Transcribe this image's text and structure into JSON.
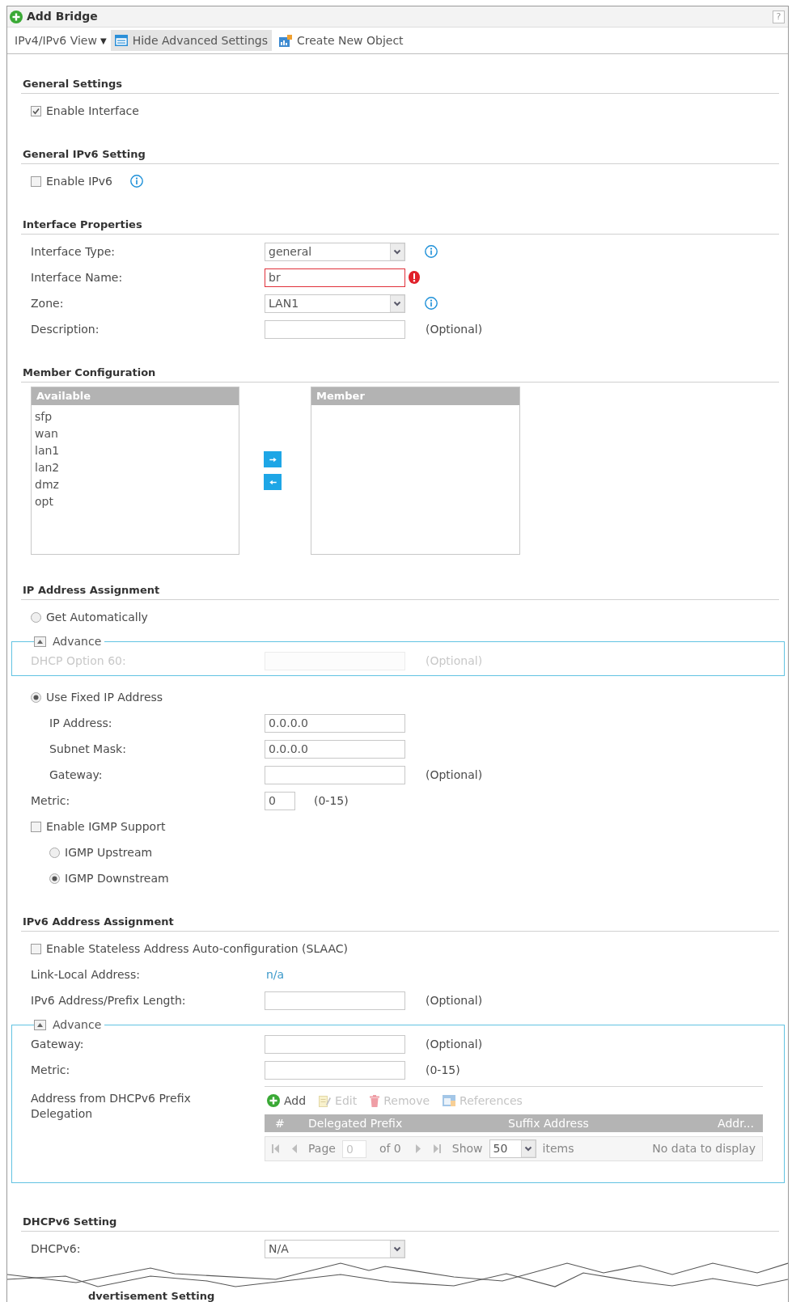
{
  "window": {
    "title": "Add Bridge",
    "help": "?"
  },
  "toolbar": [
    {
      "kind": "menu",
      "label": "IPv4/IPv6 View",
      "caret": "▼",
      "active": false
    },
    {
      "kind": "advanced",
      "label": "Hide Advanced Settings",
      "active": true
    },
    {
      "kind": "create",
      "label": "Create New Object",
      "active": false
    }
  ],
  "sections": [
    {
      "heading": "General Settings",
      "rows": [
        {
          "kind": "checkbox",
          "label": "Enable Interface",
          "checked": true
        }
      ]
    },
    {
      "heading": "General IPv6 Setting",
      "rows": [
        {
          "kind": "checkbox",
          "label": "Enable IPv6",
          "checked": false,
          "info": true
        }
      ]
    },
    {
      "heading": "Interface Properties",
      "rows": [
        {
          "kind": "select",
          "label": "Interface Type:",
          "value": "general",
          "info": true
        },
        {
          "kind": "text",
          "label": "Interface Name:",
          "value": "br",
          "error": true
        },
        {
          "kind": "select",
          "label": "Zone:",
          "value": "LAN1",
          "info": true
        },
        {
          "kind": "text",
          "label": "Description:",
          "note": "(Optional)"
        }
      ]
    },
    {
      "heading": "Member Configuration",
      "rows": [
        {
          "kind": "members",
          "available": {
            "title": "Available",
            "items": [
              {
                "label": "sfp",
                "selected": false
              },
              {
                "label": "wan",
                "selected": false
              },
              {
                "label": "lan1",
                "selected": false
              },
              {
                "label": "lan2",
                "selected": false
              },
              {
                "label": "dmz",
                "selected": false
              },
              {
                "label": "opt",
                "selected": false
              }
            ]
          },
          "member": {
            "title": "Member"
          }
        }
      ]
    },
    {
      "heading": "IP Address Assignment",
      "rows": [
        {
          "kind": "radio",
          "label": "Get Automatically",
          "selected": false
        },
        {
          "kind": "advance",
          "legend": "Advance",
          "expanded": true,
          "rows": [
            {
              "kind": "text",
              "label": "DHCP Option 60:",
              "note": "(Optional)",
              "disabled": true
            }
          ]
        },
        {
          "kind": "radio",
          "label": "Use Fixed IP Address",
          "selected": true,
          "children": [
            {
              "kind": "text",
              "label": "IP Address:",
              "value": "0.0.0.0"
            },
            {
              "kind": "text",
              "label": "Subnet Mask:",
              "value": "0.0.0.0"
            },
            {
              "kind": "text",
              "label": "Gateway:",
              "note": "(Optional)"
            }
          ]
        },
        {
          "kind": "short",
          "label": "Metric:",
          "value": "0",
          "note": "(0-15)"
        },
        {
          "kind": "checkbox",
          "label": "Enable IGMP Support",
          "checked": false,
          "children": [
            {
              "kind": "radio",
              "label": "IGMP Upstream",
              "selected": false
            },
            {
              "kind": "radio",
              "label": "IGMP Downstream",
              "selected": true
            }
          ]
        }
      ]
    },
    {
      "heading": "IPv6 Address Assignment",
      "rows": [
        {
          "kind": "checkbox",
          "label": "Enable Stateless Address Auto-configuration (SLAAC)",
          "checked": false
        },
        {
          "kind": "static",
          "label": "Link-Local Address:",
          "value": "n/a"
        },
        {
          "kind": "text",
          "label": "IPv6 Address/Prefix Length:",
          "note": "(Optional)"
        },
        {
          "kind": "advance",
          "legend": "Advance",
          "expanded": true,
          "rows": [
            {
              "kind": "text",
              "label": "Gateway:",
              "note": "(Optional)"
            },
            {
              "kind": "text",
              "label": "Metric:",
              "note": "(0-15)"
            },
            {
              "kind": "grid",
              "label": "Address from DHCPv6 Prefix Delegation",
              "actions": [
                {
                  "kind": "add",
                  "label": "Add",
                  "disabled": false
                },
                {
                  "kind": "edit",
                  "label": "Edit",
                  "disabled": true
                },
                {
                  "kind": "remove",
                  "label": "Remove",
                  "disabled": true
                },
                {
                  "kind": "references",
                  "label": "References",
                  "disabled": true
                }
              ],
              "columns": [
                "#",
                "Delegated Prefix",
                "Suffix Address",
                "Addr..."
              ],
              "pager": {
                "page_label": "Page",
                "page": "0",
                "of": "of 0",
                "show_label": "Show",
                "per_page": "50",
                "items_label": "items",
                "empty": "No data to display"
              }
            }
          ]
        }
      ]
    },
    {
      "heading": "DHCPv6 Setting",
      "rows": [
        {
          "kind": "select",
          "label": "DHCPv6:",
          "value": "N/A"
        }
      ]
    }
  ],
  "torn_heading": "dvertisement Setting"
}
